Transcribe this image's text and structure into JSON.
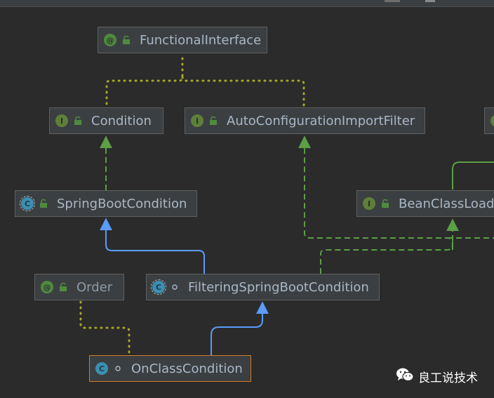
{
  "nodes": {
    "functional_interface": {
      "label": "FunctionalInterface",
      "badge": "@"
    },
    "condition": {
      "label": "Condition",
      "badge": "I"
    },
    "auto_config_filter": {
      "label": "AutoConfigurationImportFilter",
      "badge": "I"
    },
    "spring_boot_condition": {
      "label": "SpringBootCondition",
      "badge": "C"
    },
    "bean_class_loader": {
      "label": "BeanClassLoade",
      "badge": "I"
    },
    "order": {
      "label": "Order",
      "badge": "@"
    },
    "filtering_spring_boot_condition": {
      "label": "FilteringSpringBootCondition",
      "badge": "C"
    },
    "on_class_condition": {
      "label": "OnClassCondition",
      "badge": "C"
    }
  },
  "watermark": {
    "text": "良工说技术",
    "icon": "wechat-icon"
  },
  "colors": {
    "background": "#2b2b2b",
    "node_fill": "#3c3f41",
    "node_border": "#5e6060",
    "selected_border": "#d07a2a",
    "implements_edge": "#5c9f45",
    "extends_edge": "#5a9cf8",
    "annotation_edge": "#a8a82b"
  }
}
